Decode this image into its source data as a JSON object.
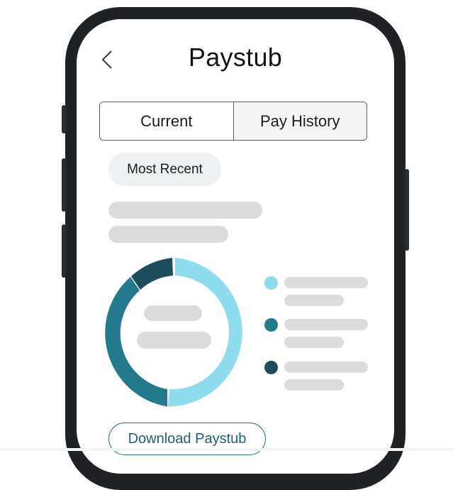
{
  "header": {
    "title": "Paystub",
    "back_icon": "chevron-left-icon"
  },
  "tabs": [
    {
      "label": "Current",
      "selected": true
    },
    {
      "label": "Pay History",
      "selected": false
    }
  ],
  "filter": {
    "label": "Most Recent"
  },
  "breakdown": {
    "segments": [
      {
        "share": 0.51,
        "color": "#8fdcef"
      },
      {
        "share": 0.37,
        "color": "#237a8c"
      },
      {
        "share": 0.12,
        "color": "#1d4d5a"
      }
    ]
  },
  "actions": {
    "download_label": "Download Paystub"
  },
  "colors": {
    "accent": "#1f5f73",
    "frame": "#202124",
    "skeleton": "#dcdcdc"
  }
}
